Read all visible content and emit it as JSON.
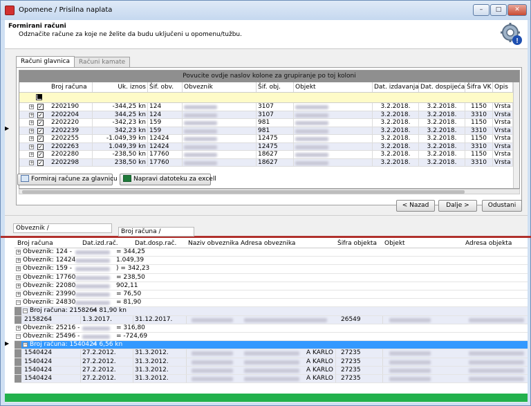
{
  "window": {
    "title": "Opomene / Prisilna naplata",
    "controls": [
      "minimize-icon",
      "maximize-icon",
      "close-icon"
    ],
    "close_glyph": "✕"
  },
  "header": {
    "title": "Formirani računi",
    "subtitle": "Odznačite račune za koje ne želite da budu uključeni u opomenu/tužbu.",
    "icon": "gear-settings-icon"
  },
  "tabs": [
    {
      "label": "Računi glavnica",
      "active": true
    },
    {
      "label": "Računi kamate",
      "active": false
    }
  ],
  "grid1": {
    "group_prompt": "Povucite ovdje naslov kolone za grupiranje po toj koloni",
    "columns": [
      "Broj računa",
      "Uk. iznos",
      "Šif. obv.",
      "Obveznik",
      "Šif. obj.",
      "Objekt",
      "Dat. izdavanja",
      "Dat. dospijeća",
      "Šifra VK",
      "Opis"
    ],
    "rows": [
      {
        "broj": "2202190",
        "iznos": "-344,25 kn",
        "sif_obv": "124",
        "sif_obj": "3107",
        "dat_izd": "3.2.2018.",
        "dat_dosp": "3.2.2018.",
        "vk": "1150",
        "opis": "Vrsta"
      },
      {
        "broj": "2202204",
        "iznos": "344,25 kn",
        "sif_obv": "124",
        "sif_obj": "3107",
        "dat_izd": "3.2.2018.",
        "dat_dosp": "3.2.2018.",
        "vk": "3310",
        "opis": "Vrsta"
      },
      {
        "broj": "2202220",
        "iznos": "-342,23 kn",
        "sif_obv": "159",
        "sif_obj": "981",
        "dat_izd": "3.2.2018.",
        "dat_dosp": "3.2.2018.",
        "vk": "1150",
        "opis": "Vrsta"
      },
      {
        "broj": "2202239",
        "iznos": "342,23 kn",
        "sif_obv": "159",
        "sif_obj": "981",
        "dat_izd": "3.2.2018.",
        "dat_dosp": "3.2.2018.",
        "vk": "3310",
        "opis": "Vrsta"
      },
      {
        "broj": "2202255",
        "iznos": "-1.049,39 kn",
        "sif_obv": "12424",
        "sif_obj": "12475",
        "dat_izd": "3.2.2018.",
        "dat_dosp": "3.2.2018.",
        "vk": "1150",
        "opis": "Vrsta"
      },
      {
        "broj": "2202263",
        "iznos": "1.049,39 kn",
        "sif_obv": "12424",
        "sif_obj": "12475",
        "dat_izd": "3.2.2018.",
        "dat_dosp": "3.2.2018.",
        "vk": "3310",
        "opis": "Vrsta"
      },
      {
        "broj": "2202280",
        "iznos": "-238,50 kn",
        "sif_obv": "17760",
        "sif_obj": "18627",
        "dat_izd": "3.2.2018.",
        "dat_dosp": "3.2.2018.",
        "vk": "1150",
        "opis": "Vrsta"
      },
      {
        "broj": "2202298",
        "iznos": "238,50 kn",
        "sif_obv": "17760",
        "sif_obj": "18627",
        "dat_izd": "3.2.2018.",
        "dat_dosp": "3.2.2018.",
        "vk": "3310",
        "opis": "Vrsta"
      }
    ]
  },
  "buttons": {
    "formiraj": "Formiraj račune za glavnicu i",
    "excel": "Napravi datoteku za excell",
    "nazad": "< Nazad",
    "dalje": "Dalje >",
    "odustani": "Odustani"
  },
  "grid2": {
    "group_boxes": [
      "Obveznik",
      "Broj računa"
    ],
    "sort_glyph": "/",
    "columns": [
      "Broj računa",
      "Dat.izd.rač.",
      "Dat.dosp.rač.",
      "Naziv obveznika",
      "Adresa obveznika",
      "Šifra objekta",
      "Objekt",
      "Adresa objekta"
    ],
    "groups": [
      {
        "prefix": "Obveznik: 124 -",
        "suffix": "= 344,25"
      },
      {
        "prefix": "Obveznik: 12424",
        "suffix": "1.049,39"
      },
      {
        "prefix": "Obveznik: 159 -",
        "suffix": ") = 342,23"
      },
      {
        "prefix": "Obveznik: 17760",
        "suffix": "= 238,50"
      },
      {
        "prefix": "Obveznik: 22080",
        "suffix": "902,11"
      },
      {
        "prefix": "Obveznik: 23990",
        "suffix": "= 76,50"
      },
      {
        "prefix": "Obveznik: 24830",
        "suffix": "= 81,90"
      }
    ],
    "sub1": {
      "label": "Broj računa: 2158264",
      "sum": "= 81,90 kn"
    },
    "sub1_row": {
      "broj": "2158264",
      "dat_izd": "1.3.2017.",
      "dat_dosp": "31.12.2017.",
      "sifra": "26549"
    },
    "groups_after": [
      {
        "prefix": "Obveznik: 25216 -",
        "suffix": "= 316,80"
      },
      {
        "prefix": "Obveznik: 25496 -",
        "suffix": "= -724,69"
      }
    ],
    "sub2": {
      "label": "Broj računa: 1540424",
      "sum": "= 6,56 kn"
    },
    "detail_rows": [
      {
        "broj": "1540424",
        "dat_izd": "27.2.2012.",
        "dat_dosp": "31.3.2012.",
        "adresa_tail": "A KARLO",
        "sifra": "27235"
      },
      {
        "broj": "1540424",
        "dat_izd": "27.2.2012.",
        "dat_dosp": "31.3.2012.",
        "adresa_tail": "A KARLO",
        "sifra": "27235"
      },
      {
        "broj": "1540424",
        "dat_izd": "27.2.2012.",
        "dat_dosp": "31.3.2012.",
        "adresa_tail": "A KARLO",
        "sifra": "27235"
      },
      {
        "broj": "1540424",
        "dat_izd": "27.2.2012.",
        "dat_dosp": "31.3.2012.",
        "adresa_tail": "A KARLO",
        "sifra": "27235"
      }
    ]
  },
  "colors": {
    "status": "#22b14c",
    "divider": "#b0302c",
    "selection": "#3399ff"
  }
}
